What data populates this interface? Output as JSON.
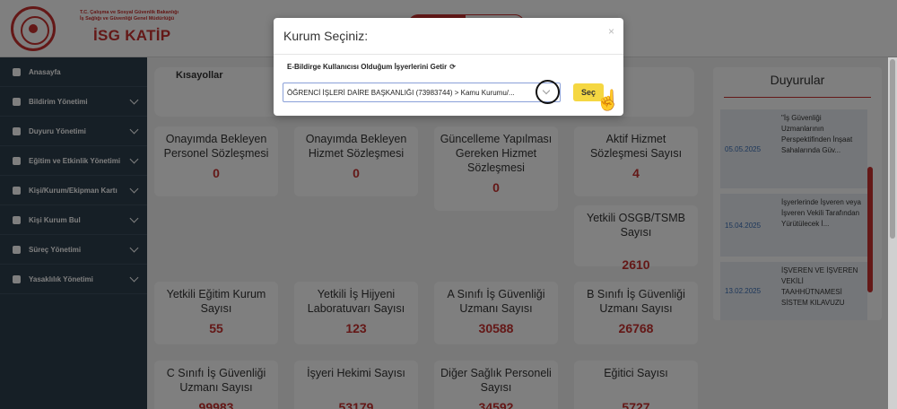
{
  "header": {
    "ministry_line1": "T.C. Çalışma ve Sosyal Güvenlik Bakanlığı",
    "ministry_line2": "İş Sağlığı ve Güvenliği Genel Müdürlüğü",
    "brand": "İSG KATİP"
  },
  "sidebar": {
    "items": [
      {
        "label": "Anasayfa",
        "icon": "home-icon",
        "has_chevron": false
      },
      {
        "label": "Bildirim Yönetimi",
        "icon": "bell-icon",
        "has_chevron": true
      },
      {
        "label": "Duyuru Yönetimi",
        "icon": "megaphone-icon",
        "has_chevron": true
      },
      {
        "label": "Eğitim ve Etkinlik Yönetimi",
        "icon": "calendar-icon",
        "has_chevron": true
      },
      {
        "label": "Kişi/Kurum/Ekipman Kartı",
        "icon": "card-icon",
        "has_chevron": true
      },
      {
        "label": "Kişi Kurum Bul",
        "icon": "search-icon",
        "has_chevron": true
      },
      {
        "label": "Süreç Yönetimi",
        "icon": "refresh-icon",
        "has_chevron": true
      },
      {
        "label": "Yasaklılık Yönetimi",
        "icon": "ban-icon",
        "has_chevron": true
      }
    ]
  },
  "shortcuts": {
    "title": "Kısayollar"
  },
  "cards": [
    {
      "title": "Onayımda Bekleyen Personel Sözleşmesi",
      "value": "0"
    },
    {
      "title": "Onayımda Bekleyen Hizmet Sözleşmesi",
      "value": "0"
    },
    {
      "title": "Güncelleme Yapılması Gereken Hizmet Sözleşmesi",
      "value": "0"
    },
    {
      "title": "Aktif Hizmet Sözleşmesi Sayısı",
      "value": "4"
    },
    {
      "title": "Yetkili OSGB/TSMB Sayısı",
      "value": "2610"
    },
    {
      "title": "Yetkili Eğitim Kurum Sayısı",
      "value": "55"
    },
    {
      "title": "Yetkili İş Hijyeni Laboratuvarı Sayısı",
      "value": "123"
    },
    {
      "title": "A Sınıfı İş Güvenliği Uzmanı Sayısı",
      "value": "30588"
    },
    {
      "title": "B Sınıfı İş Güvenliği Uzmanı Sayısı",
      "value": "26768"
    },
    {
      "title": "C Sınıfı İş Güvenliği Uzmanı Sayısı",
      "value": "99983"
    },
    {
      "title": "İşyeri Hekimi Sayısı",
      "value": "53179"
    },
    {
      "title": "Diğer Sağlık Personeli Sayısı",
      "value": "34592"
    },
    {
      "title": "Eğitici Sayısı",
      "value": "5727"
    }
  ],
  "announcements": {
    "title": "Duyurular",
    "items": [
      {
        "date": "05.05.2025",
        "text": "\"İş Güvenliği Uzmanlarının Perspektifinden İnşaat Sahalarında Güv..."
      },
      {
        "date": "15.04.2025",
        "text": "İşyerlerinde İşveren veya İşveren Vekili Tarafından Yürütülecek İ..."
      },
      {
        "date": "13.02.2025",
        "text": "İŞVEREN VE İŞVEREN VEKİLİ TAAHHÜTNAMESİ SİSTEM KILAVUZU"
      }
    ]
  },
  "modal": {
    "title": "Kurum Seçiniz:",
    "close": "×",
    "label": "E-Bildirge Kullanıcısı Olduğum İşyerlerini Getir",
    "refresh_icon": "refresh-icon",
    "selected": "ÖĞRENCİ İŞLERİ DAİRE BAŞKANLIĞI (73983744) > Kamu Kurumu/...",
    "button": "Seç"
  }
}
